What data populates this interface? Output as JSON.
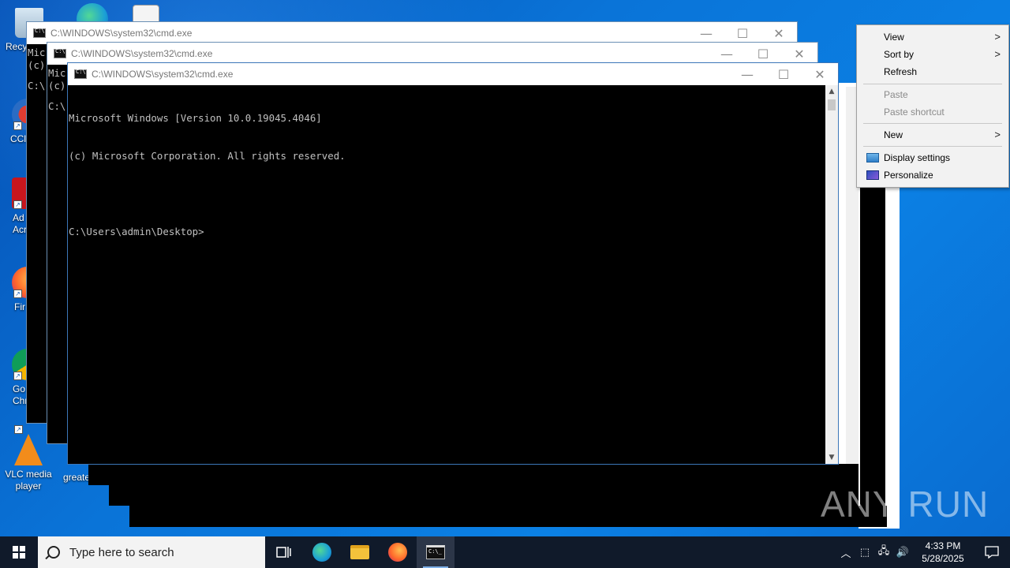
{
  "desktop": {
    "icons": [
      {
        "label": "Recy"
      },
      {
        "label": "CCl"
      },
      {
        "label": "Ad\nAcr"
      },
      {
        "label": "Fir"
      },
      {
        "label": "Go\nChr"
      },
      {
        "label": "VLC media\nplayer"
      },
      {
        "label": "greate"
      }
    ]
  },
  "windows": [
    {
      "title": "C:\\WINDOWS\\system32\\cmd.exe",
      "partial_lines": [
        "Mic",
        "(c)",
        "",
        "C:\\"
      ]
    },
    {
      "title": "C:\\WINDOWS\\system32\\cmd.exe",
      "partial_lines": [
        "Mic",
        "(c)",
        "",
        "C:\\"
      ]
    },
    {
      "title": "C:\\WINDOWS\\system32\\cmd.exe",
      "lines": [
        "Microsoft Windows [Version 10.0.19045.4046]",
        "(c) Microsoft Corporation. All rights reserved.",
        "",
        "C:\\Users\\admin\\Desktop>"
      ]
    }
  ],
  "window_buttons": {
    "minimize": "—",
    "maximize": "☐",
    "close": "✕"
  },
  "context_menu": {
    "items": [
      {
        "label": "View",
        "submenu": true,
        "disabled": false
      },
      {
        "label": "Sort by",
        "submenu": true,
        "disabled": false
      },
      {
        "label": "Refresh",
        "submenu": false,
        "disabled": false
      },
      {
        "label": "Paste",
        "submenu": false,
        "disabled": true
      },
      {
        "label": "Paste shortcut",
        "submenu": false,
        "disabled": true
      },
      {
        "label": "New",
        "submenu": true,
        "disabled": false
      },
      {
        "label": "Display settings",
        "icon": "display-settings-icon",
        "disabled": false
      },
      {
        "label": "Personalize",
        "icon": "personalize-icon",
        "disabled": false
      }
    ]
  },
  "taskbar": {
    "search_placeholder": "Type here to search",
    "apps": [
      "task-view-icon",
      "edge-icon",
      "file-explorer-icon",
      "firefox-icon",
      "cmd-icon"
    ],
    "clock_time": "4:33 PM",
    "clock_date": "5/28/2025"
  },
  "watermark": "ANY RUN",
  "colors": {
    "taskbar": "#101a2a",
    "desktop": "#0a74d8",
    "accent": "#7fb0e8"
  }
}
